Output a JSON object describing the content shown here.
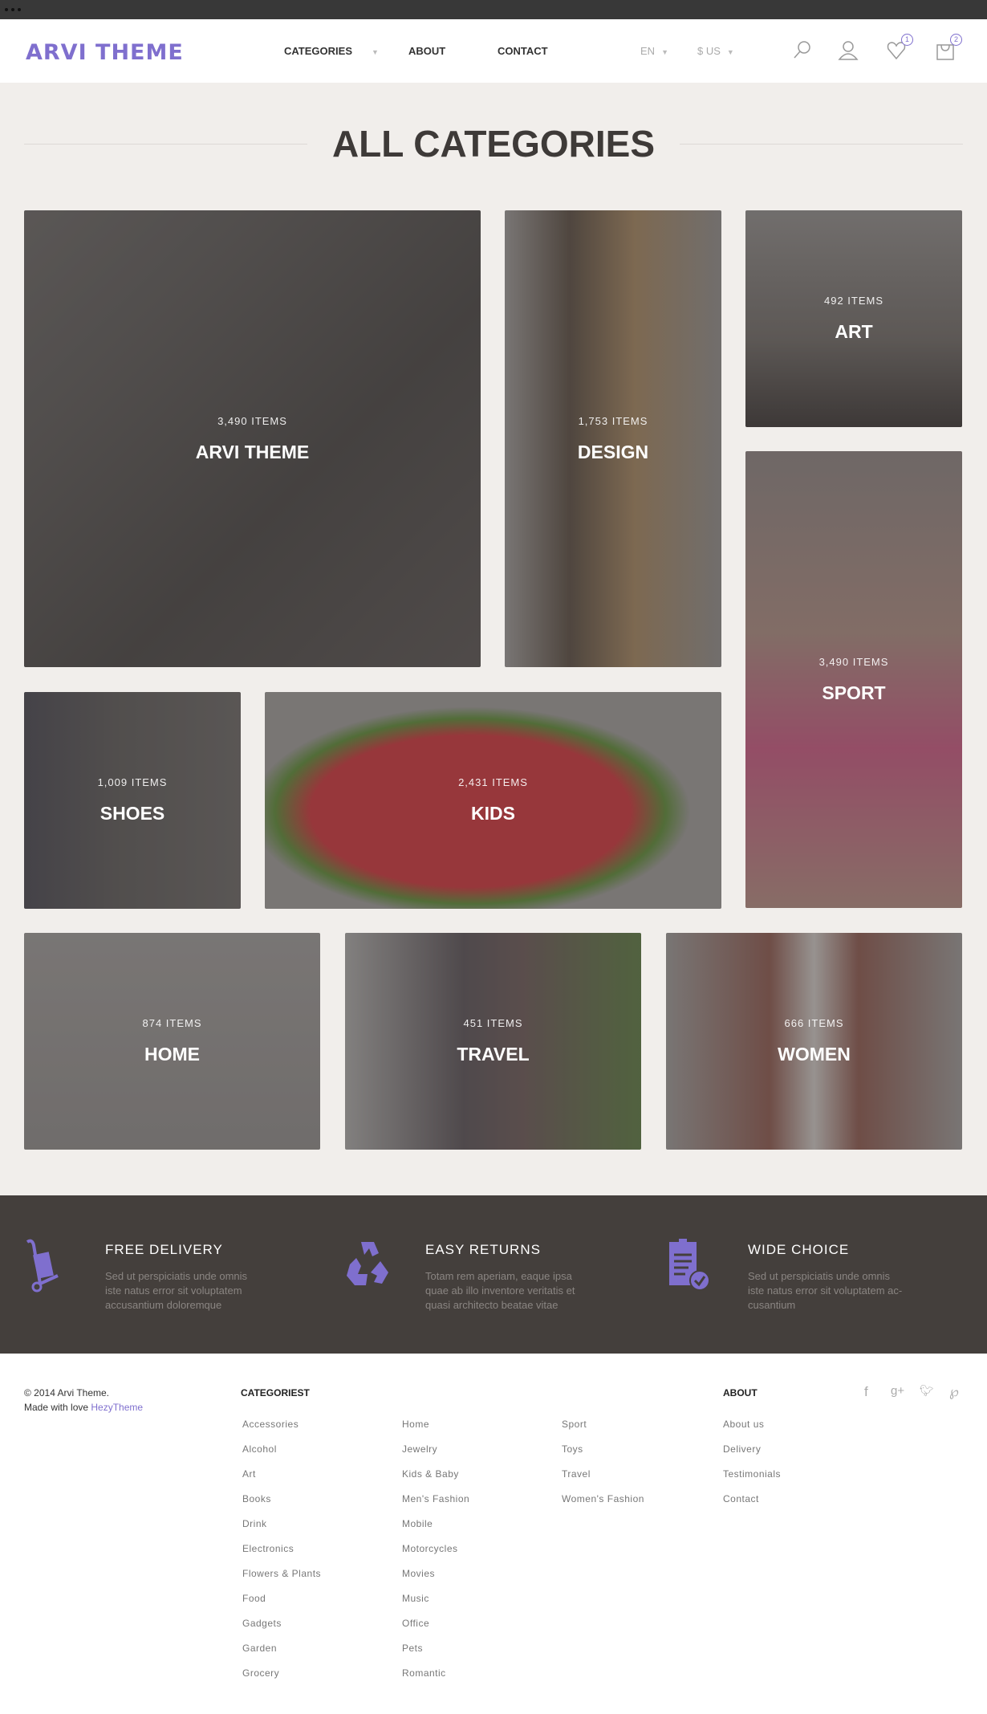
{
  "header": {
    "logo": "ARVI THEME",
    "nav": [
      {
        "label": "CATEGORIES",
        "has_dropdown": true
      },
      {
        "label": "ABOUT"
      },
      {
        "label": "CONTACT"
      }
    ],
    "language": "EN",
    "currency": "$ US",
    "wishlist_count": "1",
    "cart_count": "2",
    "accent_color": "#7f6fce"
  },
  "page_title": "ALL CATEGORIES",
  "tiles": [
    {
      "name": "ARVI THEME",
      "count": "3,490 ITEMS"
    },
    {
      "name": "DESIGN",
      "count": "1,753 ITEMS"
    },
    {
      "name": "ART",
      "count": "492 ITEMS"
    },
    {
      "name": "SPORT",
      "count": "3,490 ITEMS"
    },
    {
      "name": "SHOES",
      "count": "1,009 ITEMS"
    },
    {
      "name": "KIDS",
      "count": "2,431 ITEMS"
    },
    {
      "name": "HOME",
      "count": "874 ITEMS"
    },
    {
      "name": "TRAVEL",
      "count": "451 ITEMS"
    },
    {
      "name": "WOMEN",
      "count": "666 ITEMS"
    }
  ],
  "features": [
    {
      "icon": "hand-truck-icon",
      "title": "FREE DELIVERY",
      "lines": [
        "Sed ut perspiciatis unde omnis",
        "iste natus error sit voluptatem",
        "accusantium doloremque"
      ]
    },
    {
      "icon": "recycle-icon",
      "title": "EASY RETURNS",
      "lines": [
        "Totam rem aperiam, eaque ipsa",
        "quae ab illo inventore veritatis et",
        "quasi architecto beatae vitae"
      ]
    },
    {
      "icon": "clipboard-check-icon",
      "title": "WIDE CHOICE",
      "lines": [
        "Sed ut perspiciatis unde omnis",
        "iste natus error sit voluptatem ac-",
        "cusantium"
      ]
    }
  ],
  "footer": {
    "copyright": "© 2014 Arvi Theme.",
    "made_with": "Made with love ",
    "made_by": "HezyTheme",
    "categories_heading": "CATEGORIEST",
    "categories": [
      [
        "Accessories",
        "Alcohol",
        "Art",
        "Books",
        "Drink",
        "Electronics",
        "Flowers & Plants",
        "Food",
        "Gadgets",
        "Garden",
        "Grocery"
      ],
      [
        "Home",
        "Jewelry",
        "Kids & Baby",
        "Men's Fashion",
        "Mobile",
        "Motorcycles",
        "Movies",
        "Music",
        "Office",
        "Pets",
        "Romantic"
      ],
      [
        "Sport",
        "Toys",
        "Travel",
        "Women's Fashion"
      ]
    ],
    "about_heading": "ABOUT",
    "about": [
      "About us",
      "Delivery",
      "Testimonials",
      "Contact"
    ],
    "social": [
      "facebook-icon",
      "google-plus-icon",
      "twitter-icon",
      "pinterest-icon"
    ]
  }
}
